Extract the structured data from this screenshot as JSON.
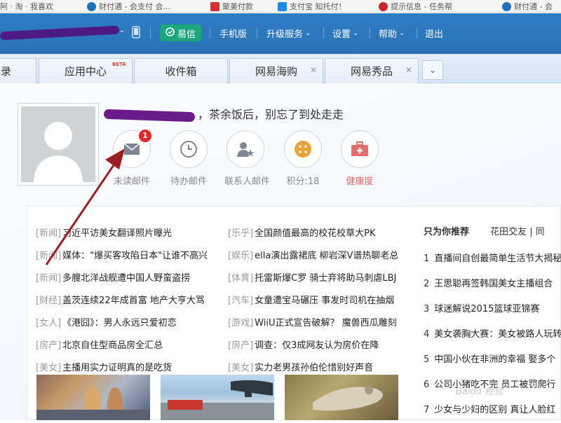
{
  "bookmarks": [
    {
      "label": "阿 · 淘 · 我喜欢",
      "icon": "globe-icon",
      "color": "#cc3333"
    },
    {
      "label": "财付通 - 会支付 会...",
      "icon": "shield-icon",
      "color": "#1f6fbf"
    },
    {
      "label": "聚美付款",
      "icon": "bookmark-icon",
      "color": "#d32f2f"
    },
    {
      "label": "支付宝 知托付！",
      "icon": "alipay-icon",
      "color": "#1e88e5"
    },
    {
      "label": "提示信息 - 任务帮",
      "icon": "puzzle-icon",
      "color": "#c62828"
    },
    {
      "label": "财付通 - 会",
      "icon": "shield-icon",
      "color": "#1f6fbf"
    }
  ],
  "header": {
    "yixin": "易信",
    "mobile": "手机版",
    "upgrade": "升级服务",
    "settings": "设置",
    "help": "帮助",
    "logout": "退出"
  },
  "tabs": [
    {
      "label": "录"
    },
    {
      "label": "应用中心",
      "badge": "BETA"
    },
    {
      "label": "收件箱"
    },
    {
      "label": "网易海购"
    },
    {
      "label": "网易秀品"
    }
  ],
  "profile": {
    "greeting": "，茶余饭后，别忘了到处走走"
  },
  "quick_items": [
    {
      "label": "未读邮件",
      "icon": "envelope-icon",
      "badge": "1",
      "color": "#7d8794"
    },
    {
      "label": "待办邮件",
      "icon": "clock-icon",
      "color": "#7d8794"
    },
    {
      "label": "联系人邮件",
      "icon": "contact-star-icon",
      "color": "#7d8794"
    },
    {
      "label": "积分:18",
      "icon": "coin-icon",
      "color": "#e8a33a"
    },
    {
      "label": "健康度",
      "icon": "medkit-icon",
      "color": "#e06c6c"
    }
  ],
  "news_left": [
    {
      "cat": "[新闻]",
      "title": "习近平访美女翻译照片曝光"
    },
    {
      "cat": "[新闻]",
      "title": "媒体：\"爆买客攻陷日本\"让谁不高兴"
    },
    {
      "cat": "[新闻]",
      "title": "多艘北洋战舰遭中国人野蛮盗捞"
    },
    {
      "cat": "[财经]",
      "title": "盖茨连续22年成首富 地产大亨大骂"
    },
    {
      "cat": "[女人]",
      "title": "《港囧》：男人永远只爱初恋"
    },
    {
      "cat": "[房产]",
      "title": "北京自住型商品房全汇总"
    },
    {
      "cat": "[美女]",
      "title": "主播用实力证明真的是吃货"
    }
  ],
  "news_mid": [
    {
      "cat": "[乐乎]",
      "title": "全国颜值最高的校花校草大PK"
    },
    {
      "cat": "[娱乐]",
      "title": "ella演出露裙底 柳岩深V谱热聊老总"
    },
    {
      "cat": "[体育]",
      "title": "托雷斯爆C罗 骑士弃将助马刺虐LBJ"
    },
    {
      "cat": "[汽车]",
      "title": "女童遭宝马碾压 事发时司机在抽烟"
    },
    {
      "cat": "[游戏]",
      "title": "WiiU正式宣告破解？ 魔兽西瓜雕刻"
    },
    {
      "cat": "[房产]",
      "title": "调查：仅3成网友认为房价在降"
    },
    {
      "cat": "[美女]",
      "title": "实力老男孩孙伯伦惜别好声音"
    }
  ],
  "recommend": {
    "title": "只为你推荐",
    "tag": "花田交友 | 同",
    "items": [
      {
        "n": "1",
        "t": "直播间自创最简单生活节大揭秘"
      },
      {
        "n": "2",
        "t": "王思聪再签韩国美女主播组合"
      },
      {
        "n": "3",
        "t": "球迷解说2015篮球亚锦赛"
      },
      {
        "n": "4",
        "t": "美女袭胸大赛：美女被路人玩转"
      },
      {
        "n": "5",
        "t": "中国小伙在非洲的幸福 娶多个"
      },
      {
        "n": "6",
        "t": "公司小猪吃不完 员工被罚爬行"
      },
      {
        "n": "7",
        "t": "少女与少妇的区别 真让人脸红"
      }
    ]
  },
  "watermark": "Baidu 经验"
}
